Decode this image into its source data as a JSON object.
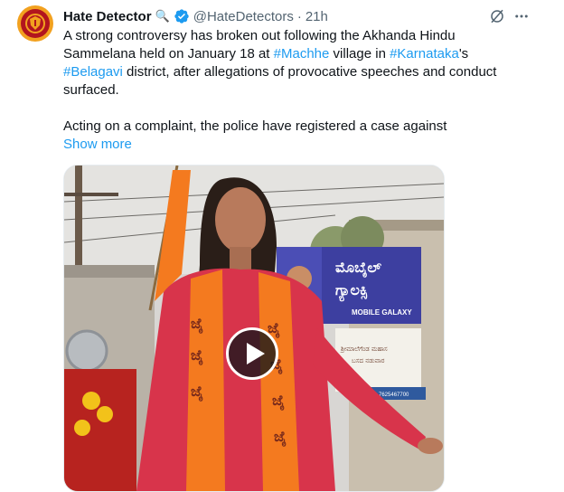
{
  "post": {
    "display_name": "Hate Detector",
    "search_emoji": "🔍",
    "handle": "@HateDetectors",
    "separator": "·",
    "time": "21h",
    "text_segments_p1": [
      {
        "t": "A strong controversy has broken out following the Akhanda Hindu Sammelana held on January 18 at ",
        "tag": false
      },
      {
        "t": "#Machhe",
        "tag": true
      },
      {
        "t": " village in ",
        "tag": false
      },
      {
        "t": "#Karnataka",
        "tag": true
      },
      {
        "t": "'s ",
        "tag": false
      },
      {
        "t": "#Belagavi",
        "tag": true
      },
      {
        "t": " district, after allegations of provocative speeches and conduct surfaced.",
        "tag": false
      }
    ],
    "text_p2": "Acting on a complaint, the police have registered a case against",
    "show_more": "Show more"
  },
  "media": {
    "signboard_text_1": "ಮೊಬೈಲ್",
    "signboard_text_2": "ಗ್ಯಾಲಕ್ಸಿ",
    "signboard_english": "MOBILE GALAXY",
    "lower_sign_text_1": "ಶ್ರೀಮಾಲೆಗೆಂಡ ಮಹಾಸ",
    "lower_sign_text_2": "ಬಸದ ನಡುವಾರ",
    "phone_text": "Mob: 7625467700",
    "scarf_letter": "ಜೈ"
  },
  "colors": {
    "link": "#1d9bf0",
    "secondary": "#536471",
    "verified": "#1d9bf0",
    "scarf": "#f47a1f",
    "dress": "#d8344b"
  },
  "icons": {
    "verified": "verified-badge-icon",
    "grok": "grok-icon",
    "more": "more-icon",
    "play": "play-icon"
  }
}
